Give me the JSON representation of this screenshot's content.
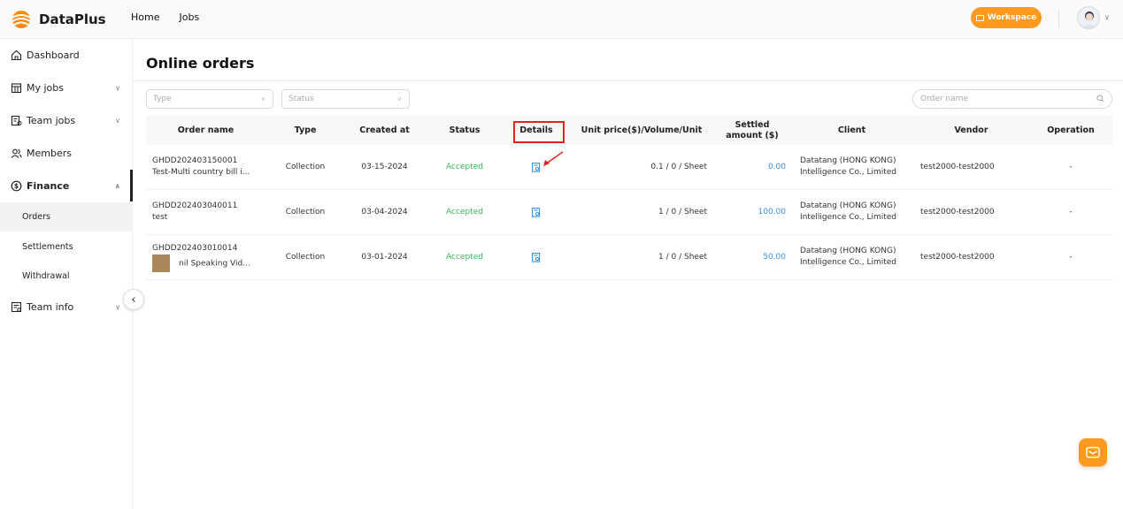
{
  "header": {
    "logo_text": "DataPlus",
    "nav": [
      "Home",
      "Jobs"
    ],
    "workspace_label": "Workspace"
  },
  "sidebar": {
    "items": [
      {
        "label": "Dashboard",
        "icon": "home-icon"
      },
      {
        "label": "My jobs",
        "icon": "calendar-icon"
      },
      {
        "label": "Team jobs",
        "icon": "task-icon"
      },
      {
        "label": "Members",
        "icon": "people-icon"
      },
      {
        "label": "Finance",
        "icon": "dollar-icon"
      },
      {
        "label": "Team info",
        "icon": "info-doc-icon"
      }
    ],
    "finance_sub": [
      "Orders",
      "Settlements",
      "Withdrawal"
    ]
  },
  "main": {
    "title": "Online orders",
    "filters": {
      "type_placeholder": "Type",
      "status_placeholder": "Status",
      "search_placeholder": "Order name"
    },
    "table": {
      "headers": [
        "Order name",
        "Type",
        "Created at",
        "Status",
        "Details",
        "Unit price($)/Volume/Unit",
        "Settled amount ($)",
        "Client",
        "Vendor",
        "Operation"
      ],
      "rows": [
        {
          "order_id": "GHDD202403150001",
          "order_name": "Test-Multi country bill i...",
          "type": "Collection",
          "created_at": "03-15-2024",
          "status": "Accepted",
          "unit_price": "0.1 / 0 / Sheet",
          "settled": "0.00",
          "client_1": "Datatang (HONG KONG)",
          "client_2": "Intelligence Co., Limited",
          "vendor": "test2000-test2000",
          "operation": "-"
        },
        {
          "order_id": "GHDD202403040011",
          "order_name": "test",
          "type": "Collection",
          "created_at": "03-04-2024",
          "status": "Accepted",
          "unit_price": "1 / 0 / Sheet",
          "settled": "100.00",
          "client_1": "Datatang (HONG KONG)",
          "client_2": "Intelligence Co., Limited",
          "vendor": "test2000-test2000",
          "operation": "-"
        },
        {
          "order_id": "GHDD202403010014",
          "order_name": "nil Speaking Vid...",
          "type": "Collection",
          "created_at": "03-01-2024",
          "status": "Accepted",
          "unit_price": "1 / 0 / Sheet",
          "settled": "50.00",
          "client_1": "Datatang (HONG KONG)",
          "client_2": "Intelligence Co., Limited",
          "vendor": "test2000-test2000",
          "operation": "-"
        }
      ]
    }
  },
  "colors": {
    "accent": "#ff9a1f",
    "accepted": "#3bb35b",
    "amount": "#3a8ee6",
    "annotation": "#e2231a"
  }
}
